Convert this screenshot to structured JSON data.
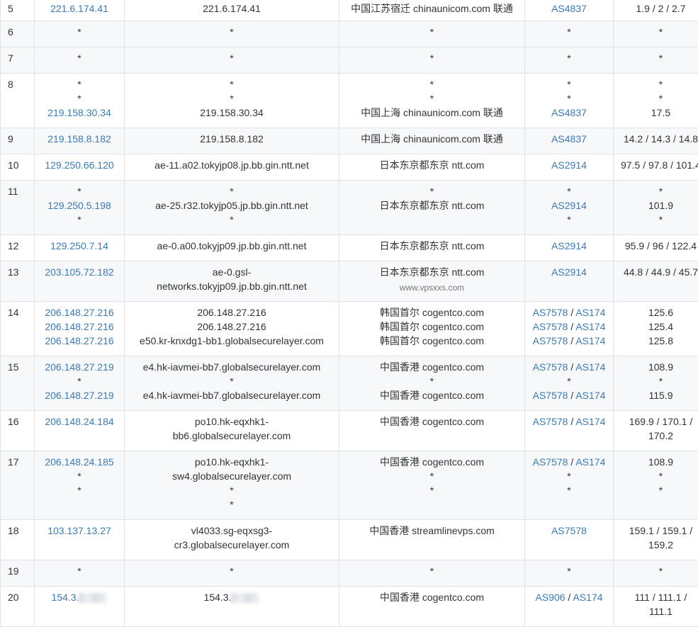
{
  "colors": {
    "link": "#3a7ab5",
    "border": "#dfe3e8",
    "stripe": "#f7f8f9",
    "text": "#333333"
  },
  "watermark": "www.vpsxxs.com",
  "hops": [
    {
      "hop": "5",
      "ips": [
        "221.6.174.41"
      ],
      "hosts": [
        "221.6.174.41"
      ],
      "locs": [
        "中国江苏宿迁 chinaunicom.com 联通"
      ],
      "asns": [
        [
          "AS4837"
        ]
      ],
      "rtts": [
        "1.9 / 2 / 2.7"
      ],
      "h": 33
    },
    {
      "hop": "6",
      "ips": [
        "*"
      ],
      "hosts": [
        "*"
      ],
      "locs": [
        "*"
      ],
      "asns": [
        [
          "*"
        ]
      ],
      "rtts": [
        "*"
      ],
      "h": 37
    },
    {
      "hop": "7",
      "ips": [
        "*"
      ],
      "hosts": [
        "*"
      ],
      "locs": [
        "*"
      ],
      "asns": [
        [
          "*"
        ]
      ],
      "rtts": [
        "*"
      ],
      "h": 37
    },
    {
      "hop": "8",
      "ips": [
        "*",
        "*",
        "219.158.30.34"
      ],
      "hosts": [
        "*",
        "*",
        "219.158.30.34"
      ],
      "locs": [
        "*",
        "*",
        "中国上海 chinaunicom.com 联通"
      ],
      "asns": [
        [
          "*"
        ],
        [
          "*"
        ],
        [
          "AS4837"
        ]
      ],
      "rtts": [
        "*",
        "*",
        "17.5"
      ],
      "h": 77
    },
    {
      "hop": "9",
      "ips": [
        "219.158.8.182"
      ],
      "hosts": [
        "219.158.8.182"
      ],
      "locs": [
        "中国上海 chinaunicom.com 联通"
      ],
      "asns": [
        [
          "AS4837"
        ]
      ],
      "rtts": [
        "14.2 / 14.3 / 14.8"
      ],
      "h": 37
    },
    {
      "hop": "10",
      "ips": [
        "129.250.66.120"
      ],
      "hosts": [
        "ae-11.a02.tokyjp08.jp.bb.gin.ntt.net"
      ],
      "locs": [
        "日本东京都东京 ntt.com"
      ],
      "asns": [
        [
          "AS2914"
        ]
      ],
      "rtts": [
        "97.5 / 97.8 / 101.4"
      ],
      "h": 37
    },
    {
      "hop": "11",
      "ips": [
        "*",
        "129.250.5.198",
        "*"
      ],
      "hosts": [
        "*",
        "ae-25.r32.tokyjp05.jp.bb.gin.ntt.net",
        "*"
      ],
      "locs": [
        "*",
        "日本东京都东京 ntt.com",
        ""
      ],
      "asns": [
        [
          "*"
        ],
        [
          "AS2914"
        ],
        [
          "*"
        ]
      ],
      "rtts": [
        "*",
        "101.9",
        "*"
      ],
      "h": 77
    },
    {
      "hop": "12",
      "ips": [
        "129.250.7.14"
      ],
      "hosts": [
        "ae-0.a00.tokyjp09.jp.bb.gin.ntt.net"
      ],
      "locs": [
        "日本东京都东京 ntt.com"
      ],
      "asns": [
        [
          "AS2914"
        ]
      ],
      "rtts": [
        "95.9 / 96 / 122.4"
      ],
      "h": 37
    },
    {
      "hop": "13",
      "ips": [
        "203.105.72.182"
      ],
      "hosts": [
        "ae-0.gsl-",
        "networks.tokyjp09.jp.bb.gin.ntt.net"
      ],
      "locs": [
        "日本东京都东京 ntt.com"
      ],
      "asns": [
        [
          "AS2914"
        ]
      ],
      "rtts": [
        "44.8 / 44.9 / 45.7"
      ],
      "h": 57,
      "watermark": true
    },
    {
      "hop": "14",
      "ips": [
        "206.148.27.216",
        "206.148.27.216",
        "206.148.27.216"
      ],
      "hosts": [
        "206.148.27.216",
        "206.148.27.216",
        "e50.kr-knxdg1-bb1.globalsecurelayer.com"
      ],
      "locs": [
        "韩国首尔 cogentco.com",
        "韩国首尔 cogentco.com",
        "韩国首尔 cogentco.com"
      ],
      "asns": [
        [
          "AS7578",
          "AS174"
        ],
        [
          "AS7578",
          "AS174"
        ],
        [
          "AS7578",
          "AS174"
        ]
      ],
      "rtts": [
        "125.6",
        "125.4",
        "125.8"
      ],
      "h": 77
    },
    {
      "hop": "15",
      "ips": [
        "206.148.27.219",
        "*",
        "206.148.27.219"
      ],
      "hosts": [
        "e4.hk-iavmei-bb7.globalsecurelayer.com",
        "*",
        "e4.hk-iavmei-bb7.globalsecurelayer.com"
      ],
      "locs": [
        "中国香港 cogentco.com",
        "*",
        "中国香港 cogentco.com"
      ],
      "asns": [
        [
          "AS7578",
          "AS174"
        ],
        [
          "*"
        ],
        [
          "AS7578",
          "AS174"
        ]
      ],
      "rtts": [
        "108.9",
        "*",
        "115.9"
      ],
      "h": 77
    },
    {
      "hop": "16",
      "ips": [
        "206.148.24.184"
      ],
      "hosts": [
        "po10.hk-eqxhk1-",
        "bb6.globalsecurelayer.com"
      ],
      "locs": [
        "中国香港 cogentco.com"
      ],
      "asns": [
        [
          "AS7578",
          "AS174"
        ]
      ],
      "rtts": [
        "169.9 / 170.1 /",
        "170.2"
      ],
      "h": 57
    },
    {
      "hop": "17",
      "ips": [
        "206.148.24.185",
        "*",
        "*"
      ],
      "hosts": [
        "po10.hk-eqxhk1-",
        "sw4.globalsecurelayer.com",
        "*",
        "*"
      ],
      "locs": [
        "中国香港 cogentco.com",
        "*",
        "*"
      ],
      "asns": [
        [
          "AS7578",
          "AS174"
        ],
        [
          "*"
        ],
        [
          "*"
        ]
      ],
      "rtts": [
        "108.9",
        "*",
        "*"
      ],
      "h": 97
    },
    {
      "hop": "18",
      "ips": [
        "103.137.13.27"
      ],
      "hosts": [
        "vl4033.sg-eqxsg3-",
        "cr3.globalsecurelayer.com"
      ],
      "locs": [
        "中国香港 streamlinevps.com"
      ],
      "asns": [
        [
          "AS7578"
        ]
      ],
      "rtts": [
        "159.1 / 159.1 /",
        "159.2"
      ],
      "h": 57
    },
    {
      "hop": "19",
      "ips": [
        "*"
      ],
      "hosts": [
        "*"
      ],
      "locs": [
        "*"
      ],
      "asns": [
        [
          "*"
        ]
      ],
      "rtts": [
        "*"
      ],
      "h": 37
    },
    {
      "hop": "20",
      "ips": [
        "154.3."
      ],
      "hosts": [
        "154.3."
      ],
      "locs": [
        "中国香港 cogentco.com"
      ],
      "asns": [
        [
          "AS906",
          "AS174"
        ]
      ],
      "rtts": [
        "111 / 111.1 /",
        "111.1"
      ],
      "h": 57,
      "redacted": true
    }
  ]
}
